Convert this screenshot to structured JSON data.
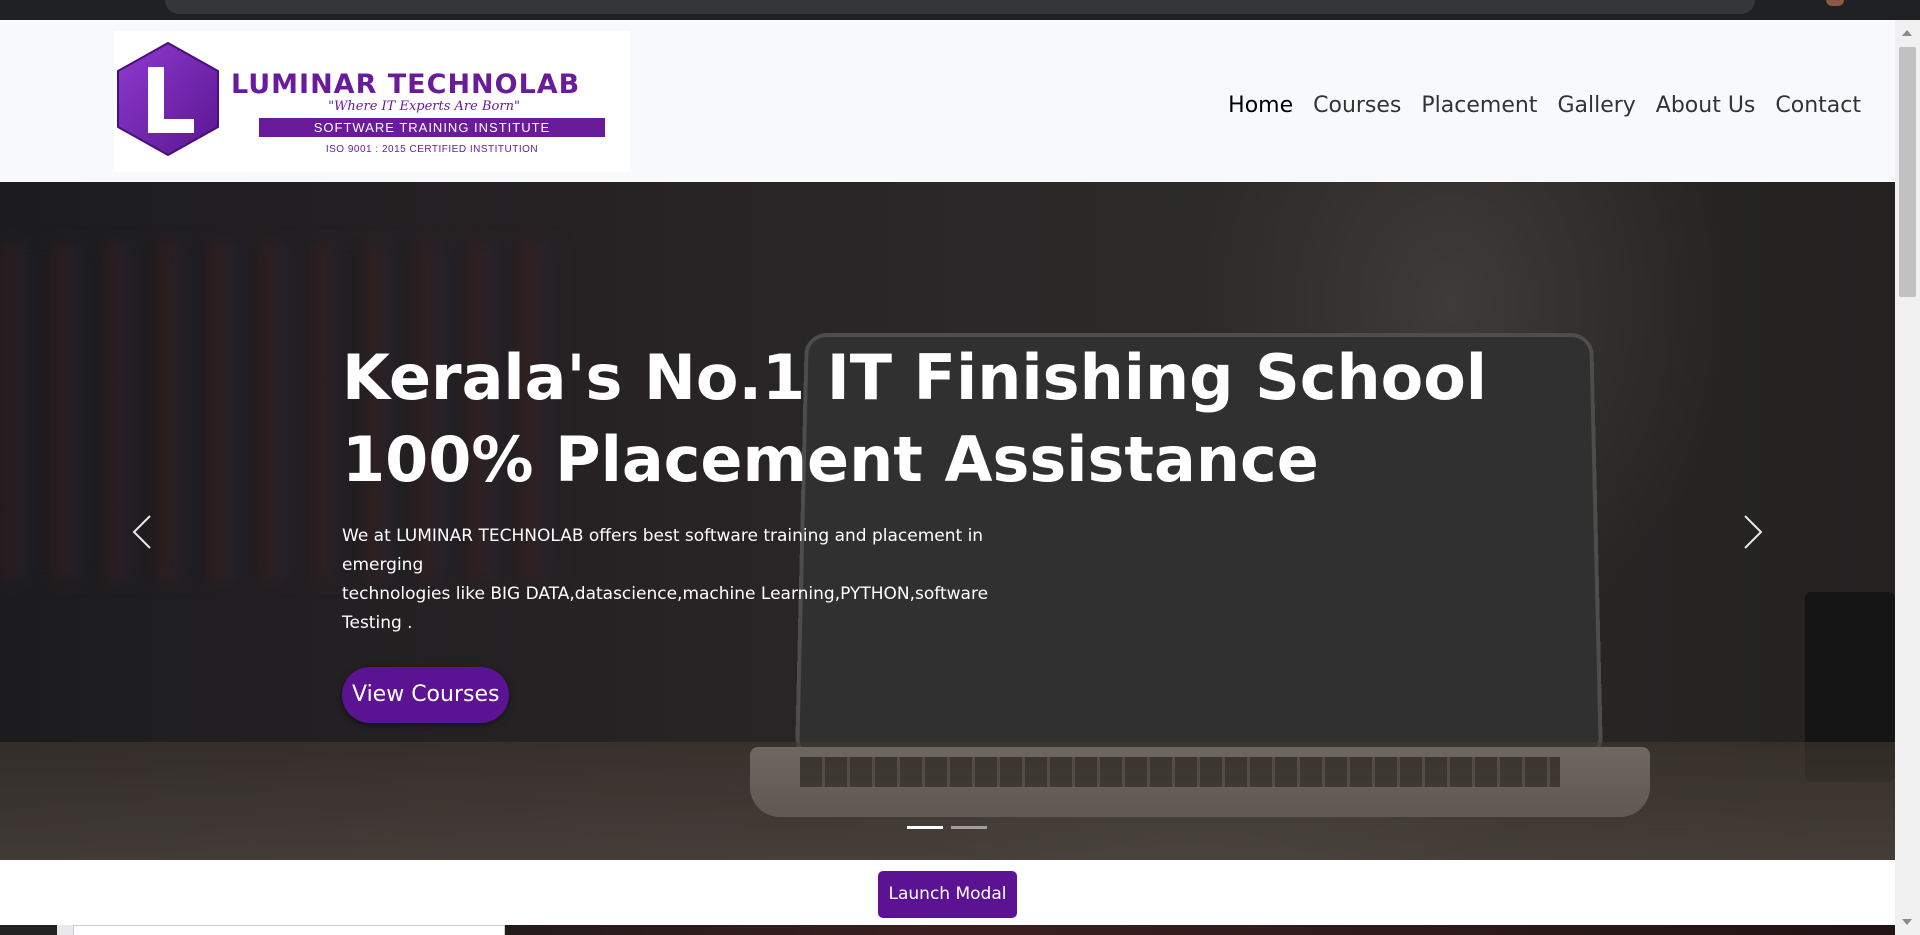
{
  "brand": {
    "name": "LUMINAR TECHNOLAB",
    "tagline": "\"Where IT Experts Are Born\"",
    "band": "SOFTWARE TRAINING INSTITUTE",
    "certification": "ISO 9001 : 2015 CERTIFIED INSTITUTION",
    "mark_letter": "L",
    "color": "#6a1b9a"
  },
  "nav": {
    "items": [
      {
        "label": "Home",
        "active": true
      },
      {
        "label": "Courses"
      },
      {
        "label": "Placement"
      },
      {
        "label": "Gallery"
      },
      {
        "label": "About Us"
      },
      {
        "label": "Contact"
      }
    ]
  },
  "hero": {
    "title_lines": [
      "Kerala's No.1 IT Finishing School",
      "100% Placement Assistance"
    ],
    "description_lines": [
      "We at LUMINAR TECHNOLAB offers best software training and placement in",
      "emerging",
      "technologies like BIG DATA,datascience,machine Learning,PYTHON,software",
      "Testing ."
    ],
    "cta_label": "View Courses",
    "cta_color": "#5b1393",
    "prev_icon": "chevron-left-icon",
    "next_icon": "chevron-right-icon",
    "slide_count": 2,
    "active_slide": 1
  },
  "modal_trigger": {
    "label": "Launch Modal",
    "color": "#5b1393"
  }
}
